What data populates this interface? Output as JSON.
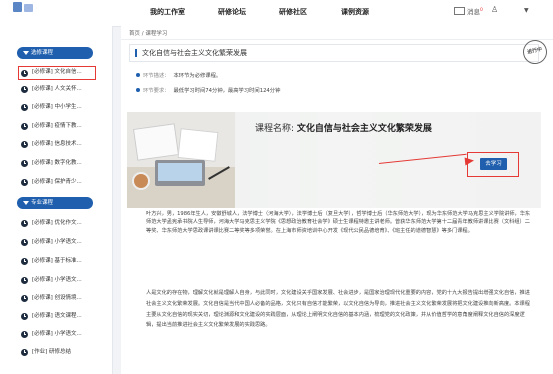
{
  "topnav": {
    "items": [
      "我的工作室",
      "研修论坛",
      "研修社区",
      "课例资源"
    ],
    "messages": "消息",
    "message_count": "0"
  },
  "sidebar": {
    "sections": [
      {
        "label": "选修课程"
      },
      {
        "label": "专业课程"
      }
    ],
    "items": [
      {
        "label": "[必修课] 文化自信..."
      },
      {
        "label": "[必修课] 人文关怀..."
      },
      {
        "label": "[必修课] 中小学生..."
      },
      {
        "label": "[必修课] 疫情下教..."
      },
      {
        "label": "[必修课] 信息技术..."
      },
      {
        "label": "[必修课] 数字化教..."
      },
      {
        "label": "[必修课] 保护青少..."
      },
      {
        "label": "[必修课] 优化作文..."
      },
      {
        "label": "[必修课] 小学语文..."
      },
      {
        "label": "[必修课] 基于标准..."
      },
      {
        "label": "[必修课] 小学语文..."
      },
      {
        "label": "[必修课] 创设情境..."
      },
      {
        "label": "[必修课] 语文课程..."
      },
      {
        "label": "[必修课] 小学语文..."
      },
      {
        "label": "[作业] 研修总结"
      }
    ]
  },
  "main": {
    "breadcrumb": "首页 / 课程学习",
    "title": "文化自信与社会主义文化繁荣发展",
    "stamp": "进行中",
    "link_desc_label": "环节描述：",
    "link_desc": "本环节为必修课程。",
    "link_req_label": "环节要求：",
    "link_req": "最低学习时间74分钟，最高学习时间124分钟",
    "course_label": "课程名称:",
    "course_name": "文化自信与社会主义文化繁荣发展",
    "go_button": "去学习",
    "bio": "叶方兴，男，1986年生人，安徽舒城人，法学博士（河海大学），法学博士后（复旦大学），哲学博士后（华东师范大学），现为华东师范大学马克思主义学院讲师，华东师范大学孟宪承书院人生导师，河海大学马克思主义学院《思想政治教育社会学》硕士生课程特邀主讲老师。曾获华东师范大学第十二届青年教师讲课比赛（文科组）二等奖、华东师范大学思政课讲课比赛二等奖等多项荣誉。在上海市师资培训中心开发《现代公民品德培育》、《班主任的道德智慧》等多门课程。",
    "paragraph": "人是文化的存在物，理解文化就是理解人自身，与此同时，文化建设关乎国家发展、社会进步，是国家治理现代化重要的内容，党的十九大报告提出增强文化自信，推进社会主义文化繁荣发展。文化自信是当代中国人必备的品格，文化只有自信才能繁荣，以文化自信为导向，推进社会主义文化繁荣发展将把文化建设推向新高度。本课程主要从文化自信的现实关切，理论渊源和文化建设的实践层面，从理论上阐明文化自信的基本内涵，梳理党的文化政策，并从价值哲学的意角度阐释文化自信的深度逻辑，提出当前推进社会主义文化繁荣发展的实践思路。"
  },
  "colors": {
    "accent": "#1f5fae",
    "highlight": "#e53935"
  }
}
